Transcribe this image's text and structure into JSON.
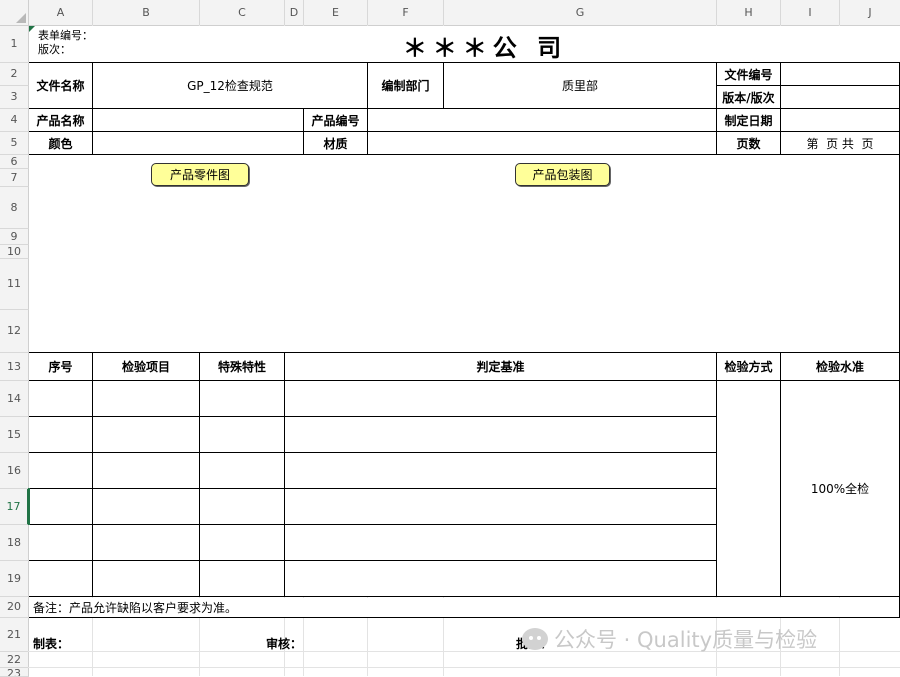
{
  "sheet": {
    "columns": [
      "A",
      "B",
      "C",
      "D",
      "E",
      "F",
      "G",
      "H",
      "I",
      "J"
    ],
    "rows": [
      "1",
      "2",
      "3",
      "4",
      "5",
      "6",
      "7",
      "8",
      "9",
      "10",
      "11",
      "12",
      "13",
      "14",
      "15",
      "16",
      "17",
      "18",
      "19",
      "20",
      "21",
      "22",
      "23"
    ],
    "selected_row": "17"
  },
  "form": {
    "form_number_label": "表单编号：",
    "edition_label": "版次：",
    "company_title": "＊＊＊公 司",
    "file_name_label": "文件名称",
    "file_name_value": "GP_12检查规范",
    "dept_label": "编制部门",
    "dept_value": "质里部",
    "file_no_label": "文件编号",
    "version_label": "版本/版次",
    "product_name_label": "产品名称",
    "product_no_label": "产品编号",
    "date_label": "制定日期",
    "color_label": "颜色",
    "material_label": "材质",
    "pages_label": "页数",
    "pages_value": "第  页 共  页",
    "btn_parts": "产品零件图",
    "btn_package": "产品包装图",
    "col_seq": "序号",
    "col_item": "检验项目",
    "col_special": "特殊特性",
    "col_criteria": "判定基准",
    "col_method": "检验方式",
    "col_level": "检验水准",
    "level_value": "100%全检",
    "note": "备注：产品允许缺陷以客户要求为准。",
    "made_by": "制表：",
    "reviewed_by": "审核：",
    "approved_by": "批准："
  },
  "watermark": {
    "text": "公众号 · Quality质量与检验"
  }
}
